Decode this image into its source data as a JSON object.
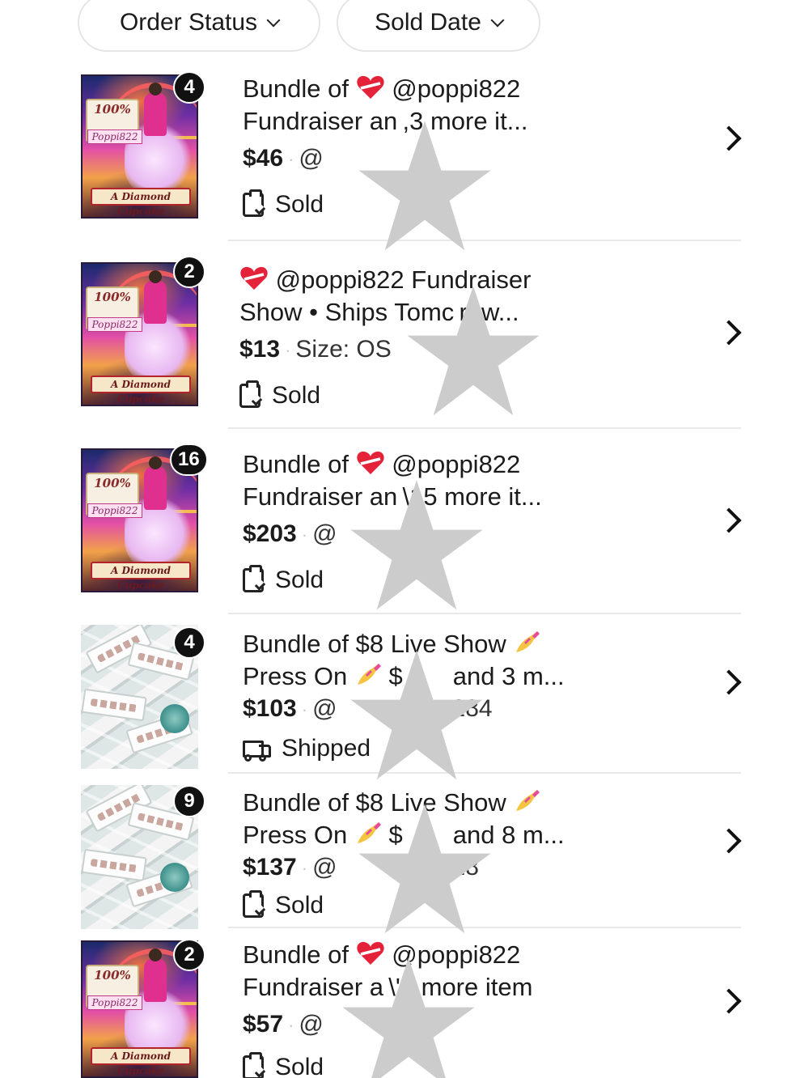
{
  "filters": {
    "order_status": "Order Status",
    "sold_date": "Sold Date"
  },
  "colors": {
    "badge": "#111111",
    "divider": "#e9e9e9",
    "redaction": "#cccccc"
  },
  "orders": [
    {
      "thumb": "unicorn",
      "count": "4",
      "title_line1_pre": "Bundle of",
      "title_line1_post": "@poppi822",
      "title_line2": "Fundraiser an ,3 more it...",
      "price": "$46",
      "meta": "@ ",
      "status": "Sold",
      "status_icon": "clipboard-check-icon",
      "thumb_text": {
        "percent": "100%",
        "name": "Poppi822",
        "banner": "A Diamond Cupcake"
      }
    },
    {
      "thumb": "unicorn",
      "count": "2",
      "title_line1_pre": "",
      "title_line1_post": "@poppi822 Fundraiser",
      "title_line2": "Show • Ships Tomc row...",
      "price": "$13",
      "meta": "Size: OS",
      "status": "Sold",
      "status_icon": "clipboard-check-icon",
      "thumb_text": {
        "percent": "100%",
        "name": "Poppi822",
        "banner": "A Diamond Cupcake"
      }
    },
    {
      "thumb": "unicorn",
      "count": "16",
      "title_line1_pre": "Bundle of",
      "title_line1_post": "@poppi822",
      "title_line2": "Fundraiser an \\15 more it...",
      "price": "$203",
      "meta": "@",
      "status": "Sold",
      "status_icon": "clipboard-check-icon",
      "thumb_text": {
        "percent": "100%",
        "name": "Poppi822",
        "banner": "A Diamond Cupcake"
      }
    },
    {
      "thumb": "nails",
      "count": "4",
      "title_line1": "Bundle of $8 Live Show",
      "title_line2_pre": "Press On",
      "title_line2_post": "$          and 3 m...",
      "price": "$103",
      "meta": "@ ",
      "meta_tail": "284",
      "status": "Shipped",
      "status_icon": "truck-icon"
    },
    {
      "thumb": "nails",
      "count": "9",
      "title_line1": "Bundle of $8 Live Show",
      "title_line2_pre": "Press On",
      "title_line2_post": "$          and 8 m...",
      "price": "$137",
      "meta": "@ ",
      "meta_tail": "28",
      "status": "Sold",
      "status_icon": "clipboard-check-icon"
    },
    {
      "thumb": "unicorn",
      "count": "2",
      "title_line1_pre": "Bundle of",
      "title_line1_post": "@poppi822",
      "title_line2": "Fundraiser a \\'1 more item",
      "price": "$57",
      "meta": "@ ",
      "status": "Sold",
      "status_icon": "clipboard-check-icon",
      "thumb_text": {
        "percent": "100%",
        "name": "Poppi822",
        "banner": "A Diamond Cupcake"
      }
    }
  ]
}
